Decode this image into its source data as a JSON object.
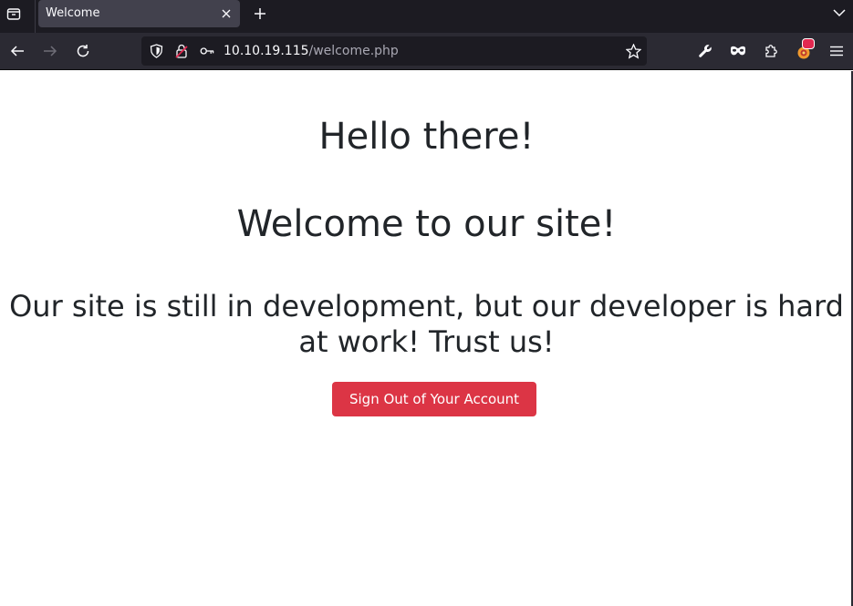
{
  "browser": {
    "tab": {
      "title": "Welcome"
    },
    "url": {
      "host": "10.10.19.115",
      "path": "/welcome.php"
    },
    "icons": {
      "tab_list": "tab-list-icon",
      "tab_close": "close-icon",
      "new_tab": "plus-icon",
      "tabs_menu": "chevron-down-icon",
      "back": "back-arrow-icon",
      "forward": "forward-arrow-icon",
      "reload": "reload-icon",
      "tracking": "shield-icon",
      "insecure": "insecure-lock-icon",
      "key": "key-icon",
      "bookmark": "star-icon",
      "tools": "wrench-icon",
      "private": "mask-icon",
      "extensions": "puzzle-icon",
      "addon": "addon-icon",
      "menu": "hamburger-menu-icon"
    }
  },
  "page": {
    "heading1": "Hello there!",
    "heading2": "Welcome to our site!",
    "message": "Our site is still in development, but our developer is hard at work! Trust us!",
    "signout_label": "Sign Out of Your Account"
  },
  "colors": {
    "chrome_dark": "#1c1b22",
    "toolbar": "#2b2a33",
    "danger": "#dc3545",
    "text": "#212529"
  }
}
